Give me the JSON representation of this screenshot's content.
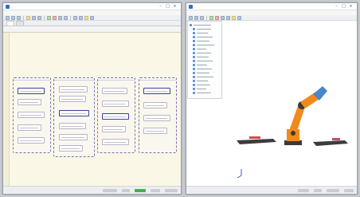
{
  "left_window": {
    "title": "",
    "menu": [
      "",
      "",
      "",
      "",
      "",
      "",
      ""
    ],
    "tabs": [
      "",
      ""
    ]
  },
  "right_window": {
    "title": "",
    "menu": [
      "",
      "",
      "",
      "",
      "",
      ""
    ]
  },
  "colors": {
    "robot_orange": "#f08a1c",
    "robot_dark": "#3a3a3a",
    "robot_blue": "#4a86c8",
    "highlight_node": "#3a3fa0",
    "status_green": "#46b04a"
  }
}
